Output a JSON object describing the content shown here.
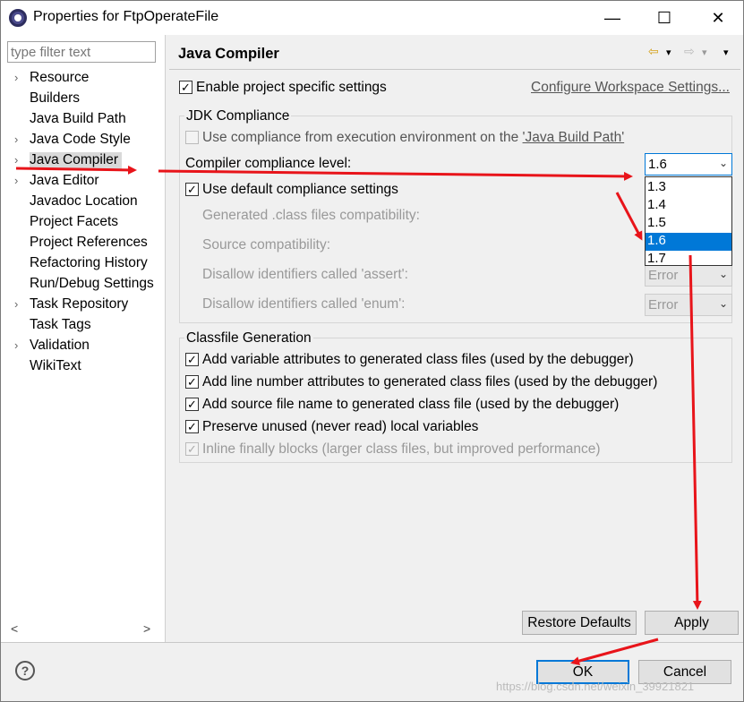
{
  "window": {
    "title": "Properties for FtpOperateFile",
    "minimize": "—",
    "maximize": "☐",
    "close": "✕"
  },
  "filter": {
    "placeholder": "type filter text"
  },
  "tree": [
    {
      "label": "Resource",
      "expandable": true
    },
    {
      "label": "Builders",
      "expandable": false
    },
    {
      "label": "Java Build Path",
      "expandable": false
    },
    {
      "label": "Java Code Style",
      "expandable": true
    },
    {
      "label": "Java Compiler",
      "expandable": true,
      "selected": true
    },
    {
      "label": "Java Editor",
      "expandable": true
    },
    {
      "label": "Javadoc Location",
      "expandable": false
    },
    {
      "label": "Project Facets",
      "expandable": false
    },
    {
      "label": "Project References",
      "expandable": false
    },
    {
      "label": "Refactoring History",
      "expandable": false
    },
    {
      "label": "Run/Debug Settings",
      "expandable": false
    },
    {
      "label": "Task Repository",
      "expandable": true
    },
    {
      "label": "Task Tags",
      "expandable": false
    },
    {
      "label": "Validation",
      "expandable": true
    },
    {
      "label": "WikiText",
      "expandable": false
    }
  ],
  "left_scroll": {
    "left": "<",
    "right": ">"
  },
  "page": {
    "title": "Java Compiler",
    "nav": {
      "back_glyph": "⇦",
      "fwd_glyph": "⇨",
      "menu_glyph": "▾"
    },
    "enable_specific": {
      "label": "Enable project specific settings",
      "checked": "✓"
    },
    "configure_link": "Configure Workspace Settings...",
    "jdk": {
      "title": "JDK Compliance",
      "use_env": "Use compliance from execution environment on the ",
      "use_env_link": "'Java Build Path'",
      "level_label": "Compiler compliance level:",
      "level_value": "1.6",
      "use_default": {
        "label": "Use default compliance settings",
        "checked": "✓"
      },
      "generated": "Generated .class files compatibility:",
      "source": "Source compatibility:",
      "assert": "Disallow identifiers called 'assert':",
      "assert_value": "Error",
      "enum": "Disallow identifiers called 'enum':",
      "enum_value": "Error",
      "options": [
        "1.3",
        "1.4",
        "1.5",
        "1.6",
        "1.7"
      ]
    },
    "classfile": {
      "title": "Classfile Generation",
      "items": [
        {
          "label": "Add variable attributes to generated class files (used by the debugger)",
          "checked": "✓"
        },
        {
          "label": "Add line number attributes to generated class files (used by the debugger)",
          "checked": "✓"
        },
        {
          "label": "Add source file name to generated class file (used by the debugger)",
          "checked": "✓"
        },
        {
          "label": "Preserve unused (never read) local variables",
          "checked": "✓"
        },
        {
          "label": "Inline finally blocks (larger class files, but improved performance)",
          "checked": "✓"
        }
      ]
    },
    "restore_defaults": "Restore Defaults",
    "apply": "Apply"
  },
  "footer": {
    "help": "?",
    "ok": "OK",
    "cancel": "Cancel"
  },
  "watermark": "https://blog.csdn.net/weixin_39921821",
  "colors": {
    "selection": "#0078d7",
    "annotation_arrow": "#e8141a"
  }
}
